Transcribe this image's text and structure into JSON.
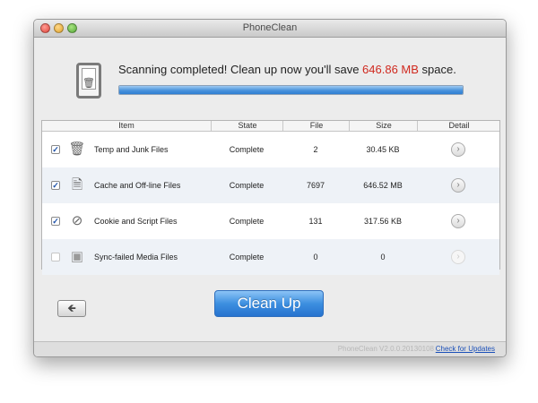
{
  "window": {
    "title": "PhoneClean"
  },
  "header": {
    "message_prefix": "Scanning completed! Clean up now you'll save ",
    "saved_size": "646.86 MB",
    "message_suffix": " space.",
    "progress_percent": 100,
    "accent_color": "#d0281e"
  },
  "table": {
    "columns": {
      "item": "Item",
      "state": "State",
      "file": "File",
      "size": "Size",
      "detail": "Detail"
    },
    "rows": [
      {
        "checked": true,
        "icon": "trash-icon",
        "name": "Temp and Junk Files",
        "state": "Complete",
        "file": "2",
        "size": "30.45 KB"
      },
      {
        "checked": true,
        "icon": "cache-document-icon",
        "name": "Cache and Off-line Files",
        "state": "Complete",
        "file": "7697",
        "size": "646.52 MB"
      },
      {
        "checked": true,
        "icon": "compass-icon",
        "name": "Cookie and Script Files",
        "state": "Complete",
        "file": "131",
        "size": "317.56 KB"
      },
      {
        "checked": false,
        "icon": "media-sync-icon",
        "name": "Sync-failed Media Files",
        "state": "Complete",
        "file": "0",
        "size": "0"
      }
    ]
  },
  "actions": {
    "clean_up_label": "Clean Up",
    "back_icon": "back-arrow-icon"
  },
  "footer": {
    "version": "PhoneClean V2.0.0.20130108",
    "update_link": "Check for Updates"
  }
}
